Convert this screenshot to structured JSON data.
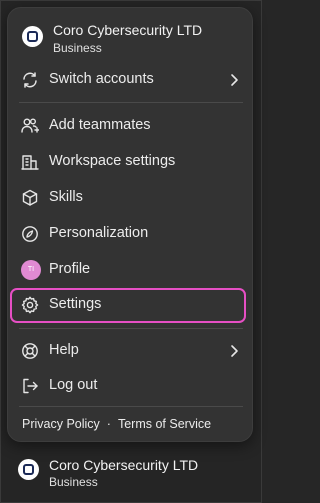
{
  "workspace": {
    "name": "Coro Cybersecurity LTD",
    "plan": "Business",
    "logo_icon": "coro-logo-icon"
  },
  "menu": {
    "switch_accounts": "Switch accounts",
    "add_teammates": "Add teammates",
    "workspace_settings": "Workspace settings",
    "skills": "Skills",
    "personalization": "Personalization",
    "profile": "Profile",
    "profile_initials": "TI",
    "settings": "Settings",
    "help": "Help",
    "log_out": "Log out"
  },
  "footer": {
    "privacy_policy": "Privacy Policy",
    "separator": "·",
    "terms_of_service": "Terms of Service"
  },
  "colors": {
    "highlight": "#e64fc4",
    "menu_bg": "#333333",
    "avatar": "#e08ad2"
  }
}
